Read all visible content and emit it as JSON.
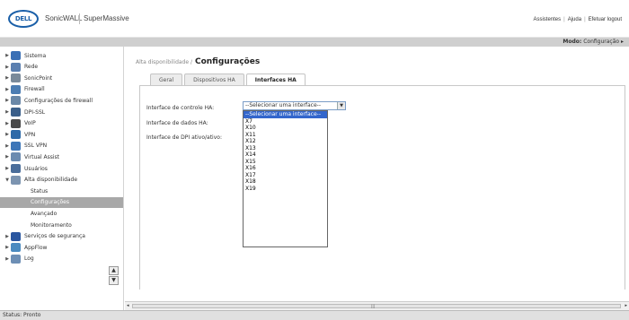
{
  "header": {
    "logo": "DELL",
    "brand": "SonicWALL",
    "product": "SuperMassive",
    "links": [
      "Assistentes",
      "Ajuda",
      "Efetuar logout"
    ]
  },
  "modebar": {
    "label": "Modo:",
    "value": "Configuração ▸"
  },
  "sidebar": {
    "items": [
      {
        "label": "Sistema",
        "arrow": "▶",
        "icon_color": "#3a6fb5"
      },
      {
        "label": "Rede",
        "arrow": "▶",
        "icon_color": "#5a7fb0"
      },
      {
        "label": "SonicPoint",
        "arrow": "▶",
        "icon_color": "#7a8a9a"
      },
      {
        "label": "Firewall",
        "arrow": "▶",
        "icon_color": "#4c7db3"
      },
      {
        "label": "Configurações de firewall",
        "arrow": "▶",
        "icon_color": "#6a88a8"
      },
      {
        "label": "DPI-SSL",
        "arrow": "▶",
        "icon_color": "#3b5f8a"
      },
      {
        "label": "VoIP",
        "arrow": "▶",
        "icon_color": "#4a4a4a"
      },
      {
        "label": "VPN",
        "arrow": "▶",
        "icon_color": "#2e6aa8"
      },
      {
        "label": "SSL VPN",
        "arrow": "▶",
        "icon_color": "#3d76b8"
      },
      {
        "label": "Virtual Assist",
        "arrow": "▶",
        "icon_color": "#6b8bb0"
      },
      {
        "label": "Usuários",
        "arrow": "▶",
        "icon_color": "#4a6d9a"
      },
      {
        "label": "Alta disponibilidade",
        "arrow": "▼",
        "icon_color": "#7c94b0"
      }
    ],
    "subitems": [
      {
        "label": "Status",
        "active": false
      },
      {
        "label": "Configurações",
        "active": true
      },
      {
        "label": "Avançado",
        "active": false
      },
      {
        "label": "Monitoramento",
        "active": false
      }
    ],
    "after": [
      {
        "label": "Serviços de segurança",
        "arrow": "▶",
        "icon_color": "#2a56a0"
      },
      {
        "label": "AppFlow",
        "arrow": "▶",
        "icon_color": "#4a8ac0"
      },
      {
        "label": "Log",
        "arrow": "▶",
        "icon_color": "#6d8fb5"
      }
    ]
  },
  "content": {
    "breadcrumb": "Alta disponibilidade /",
    "title": "Configurações",
    "tabs": [
      {
        "label": "Geral",
        "active": false
      },
      {
        "label": "Dispositivos HA",
        "active": false
      },
      {
        "label": "Interfaces HA",
        "active": true
      }
    ],
    "fields": [
      {
        "label": "Interface de controle HA:"
      },
      {
        "label": "Interface de dados HA:"
      },
      {
        "label": "Interface de DPI ativo/ativo:"
      }
    ],
    "select": {
      "value": "--Selecionar uma interface--",
      "options": [
        "--Selecionar uma interface--",
        "X7",
        "X10",
        "X11",
        "X12",
        "X13",
        "X14",
        "X15",
        "X16",
        "X17",
        "X18",
        "X19"
      ]
    }
  },
  "status": "Status: Pronto"
}
